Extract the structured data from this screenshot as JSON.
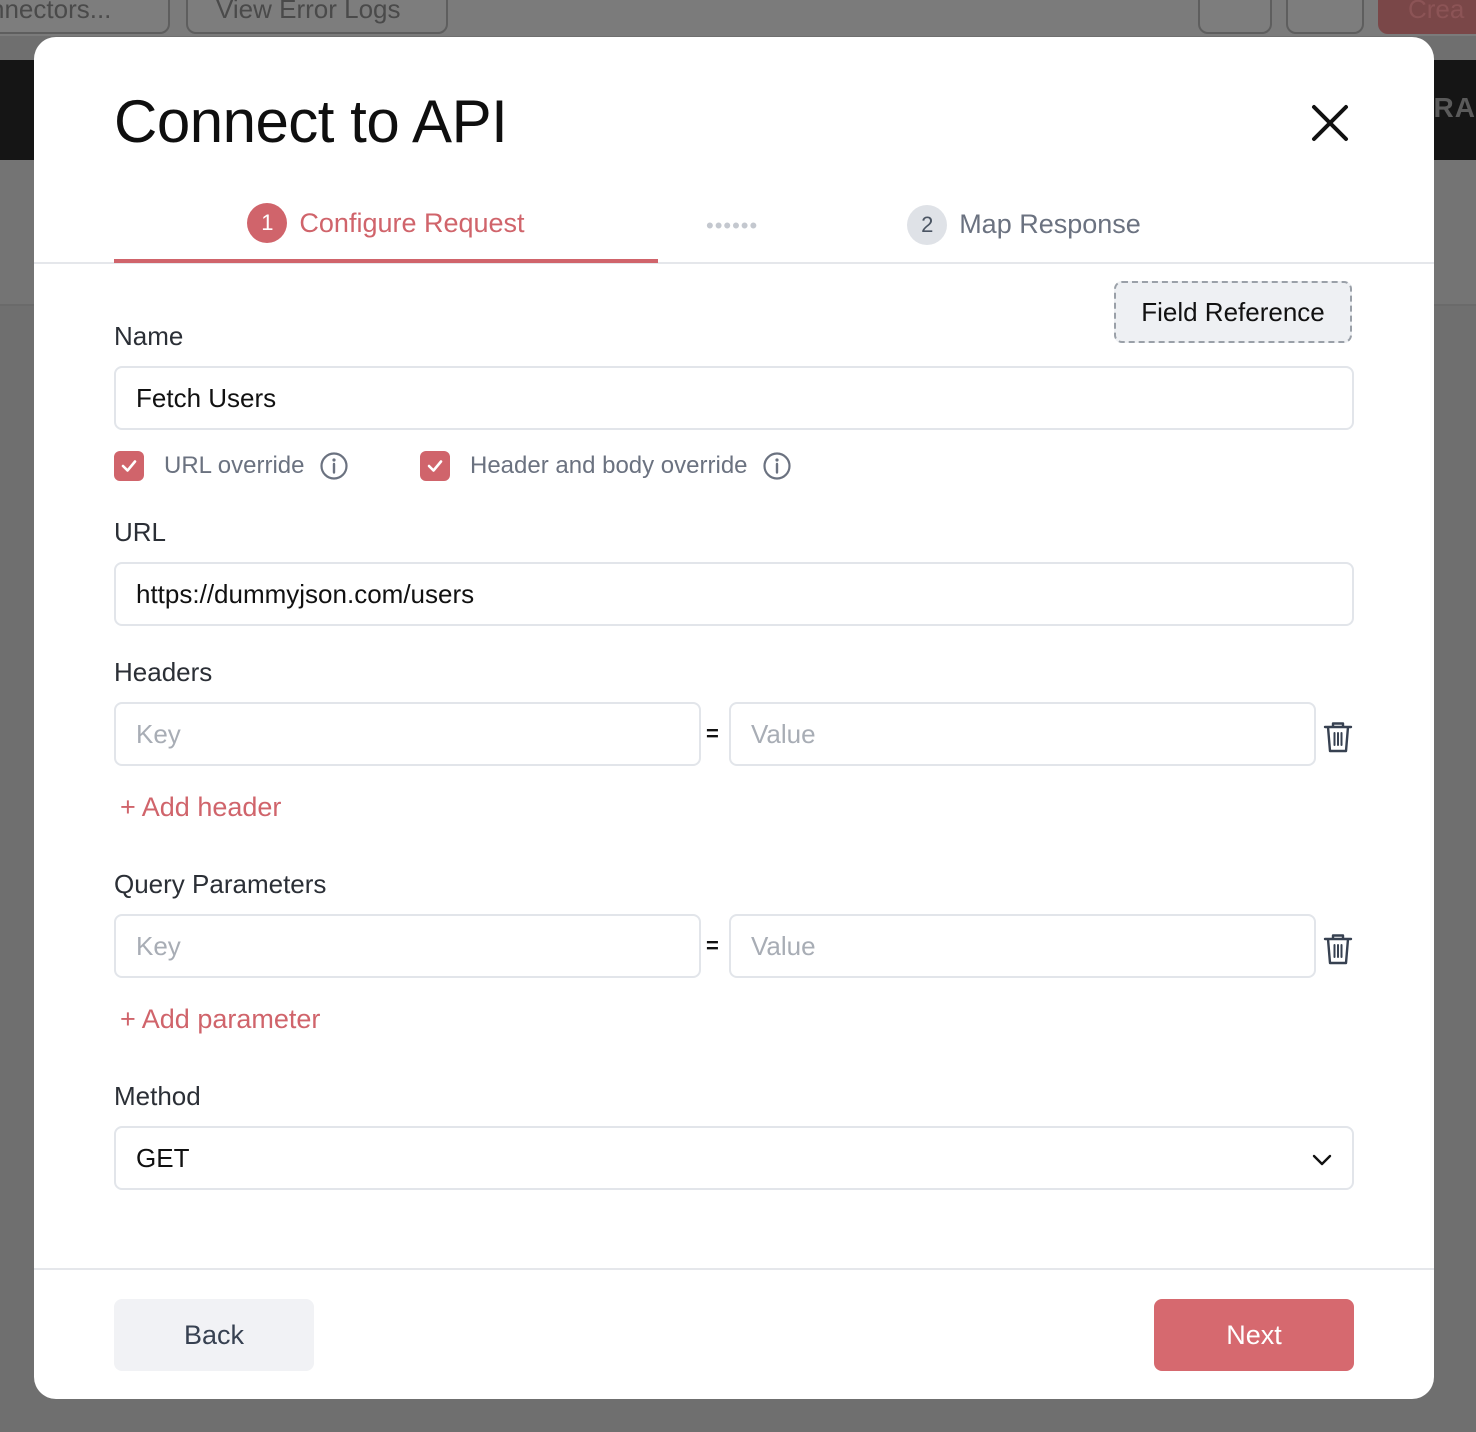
{
  "background": {
    "toolbar_buttons": [
      "nnectors...",
      "View Error Logs"
    ],
    "create_button": "Crea",
    "darkbar_text": "RA"
  },
  "modal": {
    "title": "Connect to API",
    "close_icon": "close-icon"
  },
  "steps": [
    {
      "number": "1",
      "label": "Configure Request",
      "active": true
    },
    {
      "number": "2",
      "label": "Map Response",
      "active": false
    }
  ],
  "step_separator": "••••••",
  "field_reference_label": "Field Reference",
  "name": {
    "label": "Name",
    "value": "Fetch Users"
  },
  "overrides": [
    {
      "label": "URL override",
      "checked": true,
      "info_icon": "info-icon"
    },
    {
      "label": "Header and body override",
      "checked": true,
      "info_icon": "info-icon"
    }
  ],
  "url": {
    "label": "URL",
    "value": "https://dummyjson.com/users"
  },
  "headers": {
    "label": "Headers",
    "key_placeholder": "Key",
    "equals": "=",
    "value_placeholder": "Value",
    "add_label": "+ Add header"
  },
  "query_params": {
    "label": "Query Parameters",
    "key_placeholder": "Key",
    "equals": "=",
    "value_placeholder": "Value",
    "add_label": "+ Add parameter"
  },
  "method": {
    "label": "Method",
    "selected": "GET"
  },
  "footer": {
    "back_label": "Back",
    "next_label": "Next"
  },
  "colors": {
    "accent": "#d0646b",
    "next_button": "#d6696f",
    "overlay": "#6f6f6f"
  }
}
